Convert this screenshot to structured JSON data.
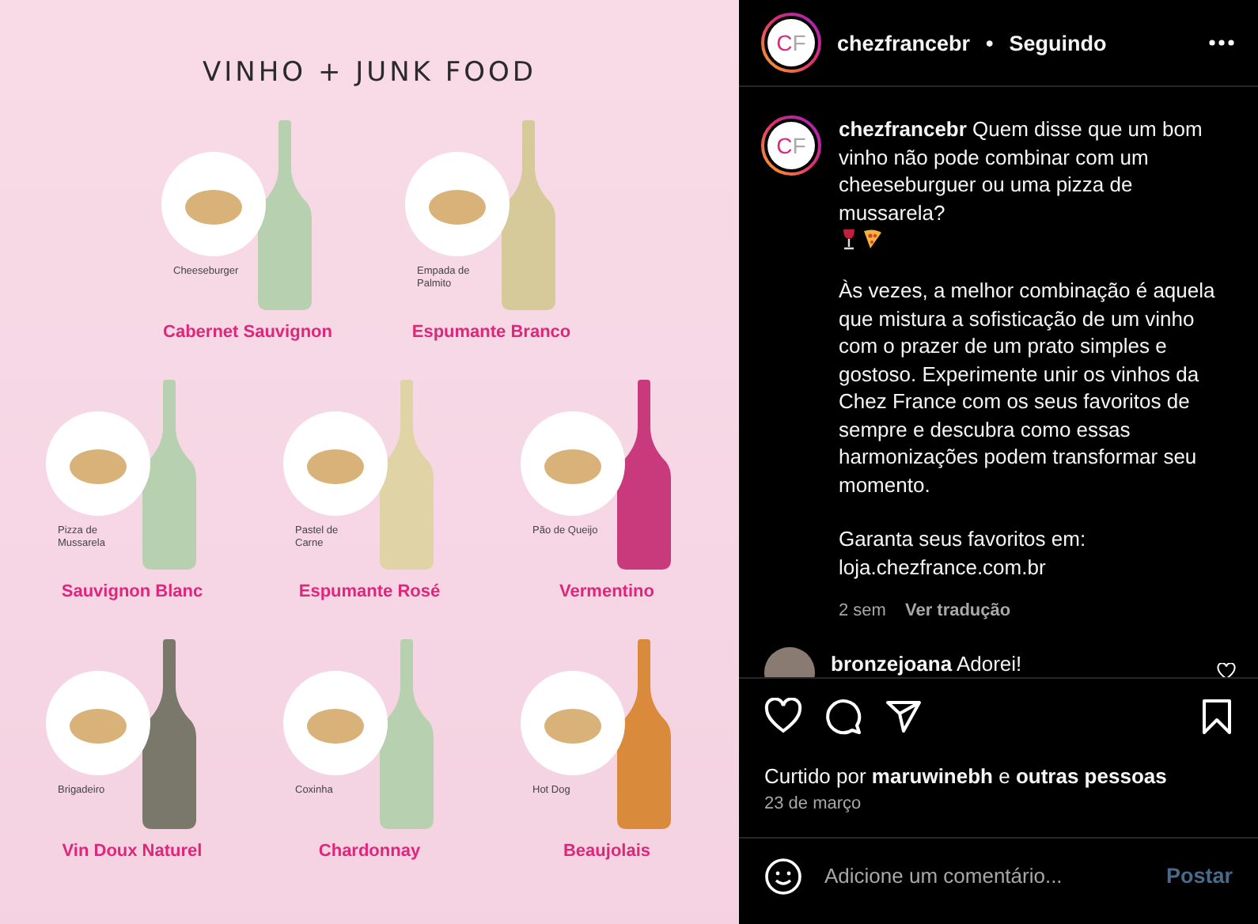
{
  "post_image": {
    "title": "VINHO + JUNK FOOD",
    "rows": [
      {
        "pairings": [
          {
            "food": "Cheeseburger",
            "wine": "Cabernet Sauvignon",
            "color": "#b7d1b0"
          },
          {
            "food": "Empada de Palmito",
            "wine": "Espumante Branco",
            "color": "#d6c99a"
          }
        ]
      },
      {
        "pairings": [
          {
            "food": "Pizza de Mussarela",
            "wine": "Sauvignon Blanc",
            "color": "#b7d1b0"
          },
          {
            "food": "Pastel de Carne",
            "wine": "Espumante Rosé",
            "color": "#e0d3a6"
          },
          {
            "food": "Pão de Queijo",
            "wine": "Vermentino",
            "color": "#c93a7c"
          }
        ]
      },
      {
        "pairings": [
          {
            "food": "Brigadeiro",
            "wine": "Vin Doux Naturel",
            "color": "#7a786a"
          },
          {
            "food": "Coxinha",
            "wine": "Chardonnay",
            "color": "#b7d1b0"
          },
          {
            "food": "Hot Dog",
            "wine": "Beaujolais",
            "color": "#d98a3a"
          }
        ]
      }
    ]
  },
  "header": {
    "avatar": "CF",
    "username": "chezfrancebr",
    "separator": "•",
    "follow_status": "Seguindo"
  },
  "caption": {
    "avatar": "CF",
    "paragraphs": [
      "**chezfrancebr** Quem disse que um bom vinho não pode combinar com um cheeseburguer ou uma pizza de mussarela?",
      "Às vezes, a melhor combinação é aquela que mistura a sofisticação de um vinho com o prazer de um prato simples e gostoso. Experimente unir os vinhos da Chez France com os seus favoritos de sempre e descubra como essas harmonizações podem transformar seu momento.",
      "Garanta seus favoritos em:"
    ],
    "link": "loja.chezfrance.com.br",
    "age": "2 sem",
    "translate": "Ver tradução"
  },
  "comments": [
    {
      "text": "**bronzejoana** Adorei!"
    }
  ],
  "likes": "Curtido por **maruwinebh** e **outras pessoas**",
  "date": "23 de março",
  "comment_input": {
    "placeholder": "Adicione um comentário...",
    "post_button": "Postar"
  }
}
